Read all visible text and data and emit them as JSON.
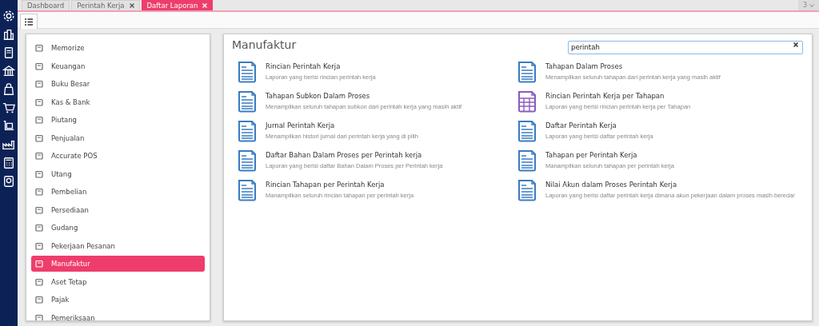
{
  "tabs": [
    {
      "label": "Dashboard",
      "selected": false,
      "closable": false
    },
    {
      "label": "Perintah Kerja",
      "selected": false,
      "closable": true
    },
    {
      "label": "Daftar Laporan",
      "selected": true,
      "closable": true
    }
  ],
  "tab_count": "3",
  "sidebar": {
    "items": [
      {
        "label": "Memorize",
        "selected": false
      },
      {
        "label": "Keuangan",
        "selected": false
      },
      {
        "label": "Buku Besar",
        "selected": false
      },
      {
        "label": "Kas & Bank",
        "selected": false
      },
      {
        "label": "Piutang",
        "selected": false
      },
      {
        "label": "Penjualan",
        "selected": false
      },
      {
        "label": "Accurate POS",
        "selected": false
      },
      {
        "label": "Utang",
        "selected": false
      },
      {
        "label": "Pembelian",
        "selected": false
      },
      {
        "label": "Persediaan",
        "selected": false
      },
      {
        "label": "Gudang",
        "selected": false
      },
      {
        "label": "Pekerjaan Pesanan",
        "selected": false
      },
      {
        "label": "Manufaktur",
        "selected": true
      },
      {
        "label": "Aset Tetap",
        "selected": false
      },
      {
        "label": "Pajak",
        "selected": false
      },
      {
        "label": "Pemeriksaan",
        "selected": false
      }
    ]
  },
  "content": {
    "title": "Manufaktur",
    "search": {
      "value": "perintah"
    },
    "reports": [
      {
        "title": "Rincian Perintah Kerja",
        "description": "Laporan yang berisi rincian perintah kerja",
        "kind": "document"
      },
      {
        "title": "Tahapan Dalam Proses",
        "description": "Menampilkan seluruh tahapan dari perintah kerja yang masih aktif",
        "kind": "document"
      },
      {
        "title": "Tahapan Subkon Dalam Proses",
        "description": "Menampilkan seluruh tahapan subkon dari perintah kerja yang masih aktif",
        "kind": "document"
      },
      {
        "title": "Rincian Perintah Kerja per Tahapan",
        "description": "Laporan yang berisi rincian perintah kerja per Tahapan",
        "kind": "grid"
      },
      {
        "title": "Jurnal Perintah Kerja",
        "description": "Menampilkan histori jurnal dari perintah kerja yang di pilih",
        "kind": "document"
      },
      {
        "title": "Daftar Perintah Kerja",
        "description": "Laporan yang berisi daftar perintah kerja",
        "kind": "document"
      },
      {
        "title": "Daftar Bahan Dalam Proses per Perintah kerja",
        "description": "Laporan yang berisi daftar Bahan Dalam Proses per Perintah kerja",
        "kind": "document"
      },
      {
        "title": "Tahapan per Perintah Kerja",
        "description": "Manampilkan seluruh tahapan per perintah kerja",
        "kind": "document"
      },
      {
        "title": "Rincian Tahapan per Perintah Kerja",
        "description": "Manampilkan seluruh rincian tahapan per perintah kerja",
        "kind": "document"
      },
      {
        "title": "Nilai Akun dalam Proses Perintah Kerja",
        "description": "Laporan yang berisi daftar perintah kerja dimana akun pekerjaan dalam proses masih beredar",
        "kind": "document"
      }
    ]
  }
}
